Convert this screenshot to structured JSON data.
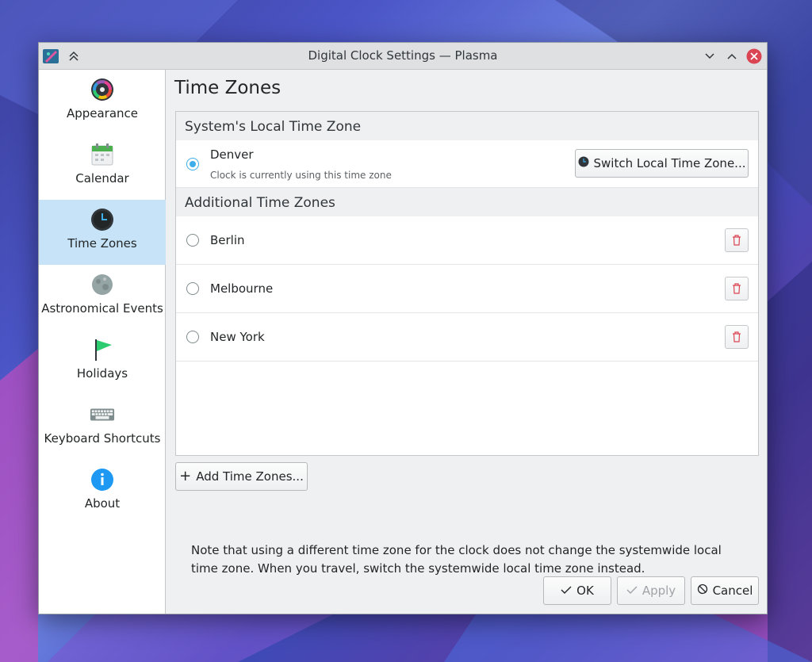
{
  "window": {
    "title": "Digital Clock Settings — Plasma"
  },
  "sidebar": {
    "items": [
      {
        "label": "Appearance",
        "icon": "appearance-icon",
        "active": false
      },
      {
        "label": "Calendar",
        "icon": "calendar-icon",
        "active": false
      },
      {
        "label": "Time Zones",
        "icon": "clock-icon",
        "active": true
      },
      {
        "label": "Astronomical Events",
        "icon": "moon-icon",
        "active": false
      },
      {
        "label": "Holidays",
        "icon": "flag-icon",
        "active": false
      },
      {
        "label": "Keyboard Shortcuts",
        "icon": "keyboard-icon",
        "active": false
      },
      {
        "label": "About",
        "icon": "info-icon",
        "active": false
      }
    ]
  },
  "page": {
    "title": "Time Zones"
  },
  "local": {
    "header": "System's Local Time Zone",
    "zone": "Denver",
    "status": "Clock is currently using this time zone",
    "switch_label": "Switch Local Time Zone..."
  },
  "additional": {
    "header": "Additional Time Zones",
    "zones": [
      "Berlin",
      "Melbourne",
      "New York"
    ]
  },
  "add_label": "Add Time Zones...",
  "note": "Note that using a different time zone for the clock does not change the systemwide local time zone. When you travel, switch the systemwide local time zone instead.",
  "footer": {
    "ok": "OK",
    "apply": "Apply",
    "cancel": "Cancel"
  },
  "colors": {
    "accent": "#3daee9",
    "selection": "#c6e3f7",
    "danger": "#da4453"
  }
}
